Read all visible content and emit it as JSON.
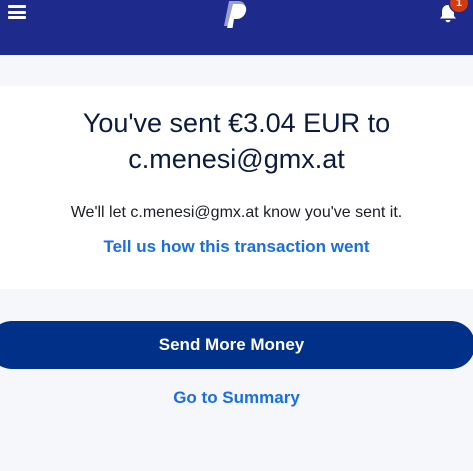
{
  "header": {
    "notification_count": "1",
    "colors": {
      "bar": "#1f2b8c",
      "badge": "#d03c0f"
    }
  },
  "confirmation": {
    "headline": "You've sent €3.04 EUR to c.menesi@gmx.at",
    "message": "We'll let c.menesi@gmx.at know you've sent it.",
    "feedback_link": "Tell us how this transaction went"
  },
  "actions": {
    "send_more": "Send More Money",
    "summary": "Go to Summary"
  },
  "colors": {
    "primary_button": "#003087",
    "link": "#1a6ee0"
  }
}
